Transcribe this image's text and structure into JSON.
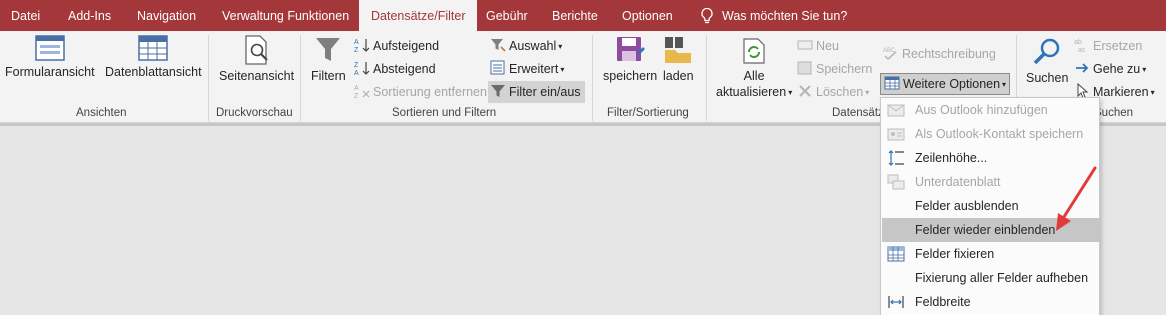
{
  "tabs": [
    {
      "label": "Datei"
    },
    {
      "label": "Add-Ins"
    },
    {
      "label": "Navigation"
    },
    {
      "label": "Verwaltung Funktionen"
    },
    {
      "label": "Datensätze/Filter",
      "active": true
    },
    {
      "label": "Gebühr"
    },
    {
      "label": "Berichte"
    },
    {
      "label": "Optionen"
    }
  ],
  "tell_me": "Was möchten Sie tun?",
  "groups": {
    "ansichten": {
      "label": "Ansichten",
      "formular": "Formularansicht",
      "datenblatt": "Datenblattansicht"
    },
    "druckvorschau": {
      "label": "Druckvorschau",
      "seitenansicht": "Seitenansicht"
    },
    "sortieren": {
      "label": "Sortieren und Filtern",
      "filtern": "Filtern",
      "aufsteigend": "Aufsteigend",
      "absteigend": "Absteigend",
      "sortierung_entfernen": "Sortierung entfernen",
      "auswahl": "Auswahl",
      "erweitert": "Erweitert",
      "filter_ein_aus": "Filter ein/aus"
    },
    "filter_sortierung": {
      "label": "Filter/Sortierung",
      "speichern": "speichern",
      "laden": "laden"
    },
    "datensaetze": {
      "label": "Datensätze",
      "alle": "Alle",
      "aktualisieren": "aktualisieren",
      "neu": "Neu",
      "speichern": "Speichern",
      "loeschen": "Löschen",
      "rechtschreibung": "Rechtschreibung",
      "weitere_optionen": "Weitere Optionen"
    },
    "suchen": {
      "label": "Suchen",
      "suchen": "Suchen",
      "ersetzen": "Ersetzen",
      "gehe_zu": "Gehe zu",
      "markieren": "Markieren"
    }
  },
  "menu": {
    "items": [
      {
        "label": "Aus Outlook hinzufügen",
        "icon": "outlook-add-icon",
        "disabled": true
      },
      {
        "label": "Als Outlook-Kontakt speichern",
        "icon": "outlook-contact-icon",
        "disabled": true
      },
      {
        "label": "Zeilenhöhe...",
        "icon": "row-height-icon",
        "disabled": false
      },
      {
        "label": "Unterdatenblatt",
        "icon": "subdatasheet-icon",
        "disabled": true
      },
      {
        "label": "Felder ausblenden",
        "icon": "",
        "disabled": false
      },
      {
        "label": "Felder wieder einblenden",
        "icon": "",
        "disabled": false,
        "highlighted": true
      },
      {
        "label": "Felder fixieren",
        "icon": "freeze-fields-icon",
        "disabled": false
      },
      {
        "label": "Fixierung aller Felder aufheben",
        "icon": "",
        "disabled": false
      },
      {
        "label": "Feldbreite",
        "icon": "field-width-icon",
        "disabled": false
      }
    ]
  },
  "colors": {
    "tabbar": "#a4373a",
    "ribbon": "#f3f3f3",
    "workspace": "#e6e6e6",
    "annotation_arrow": "#e03c3c"
  }
}
